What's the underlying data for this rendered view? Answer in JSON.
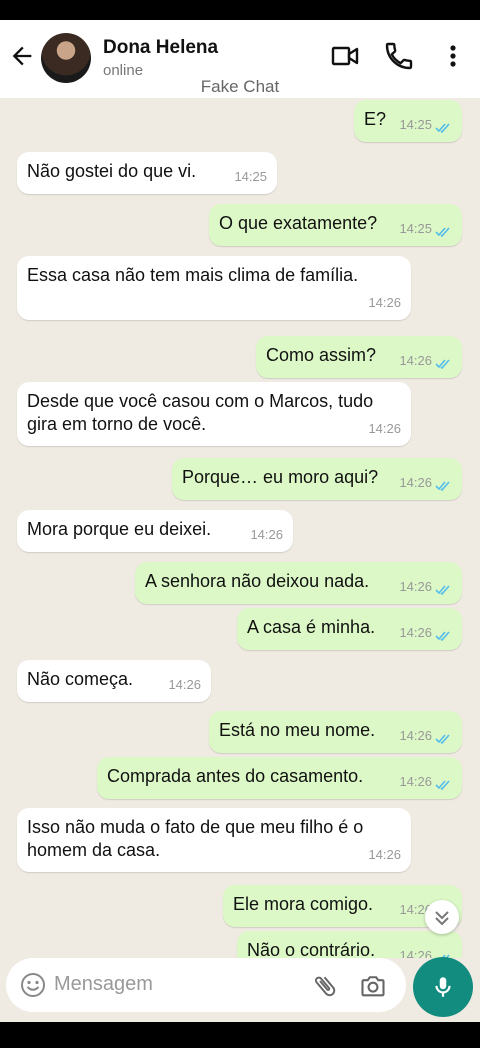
{
  "header": {
    "contact_name": "Dona Helena",
    "status": "online",
    "watermark": "Fake Chat",
    "icons": [
      "back-arrow-icon",
      "avatar",
      "video-call-icon",
      "phone-icon",
      "more-vert-icon"
    ]
  },
  "colors": {
    "outgoing": "#dcf8c6",
    "incoming": "#ffffff",
    "background": "#efeae2",
    "ticks": "#53bdeb",
    "accent": "#128c7e"
  },
  "messages": [
    {
      "dir": "out",
      "text": "E?",
      "time": "14:25"
    },
    {
      "dir": "in",
      "text": "Não gostei do que vi.",
      "time": "14:25"
    },
    {
      "dir": "out",
      "text": "O que exatamente?",
      "time": "14:25"
    },
    {
      "dir": "in",
      "text": "Essa casa não tem mais clima de família.",
      "time": "14:26"
    },
    {
      "dir": "out",
      "text": "Como assim?",
      "time": "14:26"
    },
    {
      "dir": "in",
      "text": "Desde que você casou com o Marcos, tudo\ngira em torno de você.",
      "time": "14:26"
    },
    {
      "dir": "out",
      "text": "Porque… eu moro aqui?",
      "time": "14:26"
    },
    {
      "dir": "in",
      "text": "Mora porque eu deixei.",
      "time": "14:26"
    },
    {
      "dir": "out",
      "text": "A senhora não deixou nada.",
      "time": "14:26"
    },
    {
      "dir": "out",
      "text": "A casa é minha.",
      "time": "14:26"
    },
    {
      "dir": "in",
      "text": "Não começa.",
      "time": "14:26"
    },
    {
      "dir": "out",
      "text": "Está no meu nome.",
      "time": "14:26"
    },
    {
      "dir": "out",
      "text": "Comprada antes do casamento.",
      "time": "14:26"
    },
    {
      "dir": "in",
      "text": "Isso não muda o fato de que meu filho é o\nhomem da casa.",
      "time": "14:26"
    },
    {
      "dir": "out",
      "text": "Ele mora comigo.",
      "time": "14:26"
    },
    {
      "dir": "out",
      "text": "Não o contrário.",
      "time": "14:26"
    }
  ],
  "composer": {
    "placeholder": "Mensagem"
  }
}
